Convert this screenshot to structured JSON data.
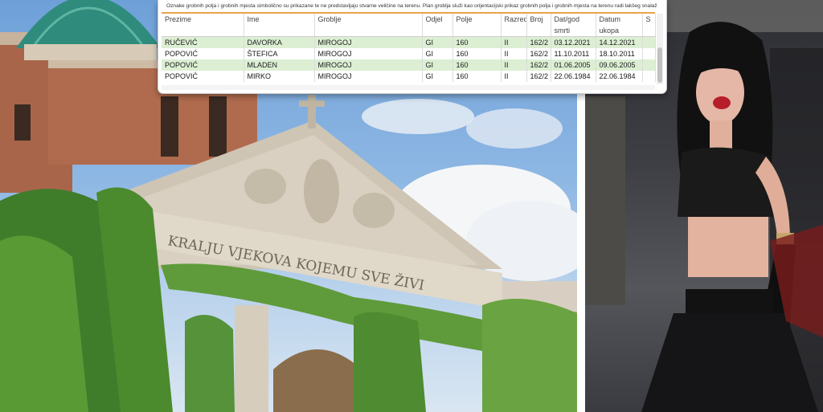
{
  "records": {
    "note": "Oznake grobnih polja i grobnih mjesta simbolično su prikazane te ne predstavljaju stvarne veličine na terenu. Plan groblja služi kao orijentacijski prikaz grobnih polja i grobnih mjesta na terenu radi lakšeg snalaženja",
    "columns": [
      "Prezime",
      "Ime",
      "Groblje",
      "Odjel",
      "Polje",
      "Razred",
      "Broj",
      "Dat/god",
      "Datum",
      "S"
    ],
    "subcolumns": [
      "",
      "",
      "",
      "",
      "",
      "",
      "",
      "smrti",
      "ukopa",
      ""
    ],
    "rows": [
      [
        "RUČEVIĆ",
        "DAVORKA",
        "MIROGOJ",
        "GI",
        "160",
        "II",
        "162/2",
        "03.12.2021",
        "14.12.2021",
        ""
      ],
      [
        "POPOVIĆ",
        "ŠTEFICA",
        "MIROGOJ",
        "GI",
        "160",
        "II",
        "162/2",
        "11.10.2011",
        "18.10.2011",
        ""
      ],
      [
        "POPOVIĆ",
        "MLADEN",
        "MIROGOJ",
        "GI",
        "160",
        "II",
        "162/2",
        "01.06.2005",
        "09.06.2005",
        ""
      ],
      [
        "POPOVIĆ",
        "MIRKO",
        "MIROGOJ",
        "GI",
        "160",
        "II",
        "162/2",
        "22.06.1984",
        "22.06.1984",
        ""
      ]
    ]
  },
  "photo_left": {
    "inscription": "KRALJU VJEKOVA KOJEMU SVE ŽIVI"
  },
  "colors": {
    "accent_rule": "#e8a44a",
    "highlight_row": "#dcefd3"
  }
}
